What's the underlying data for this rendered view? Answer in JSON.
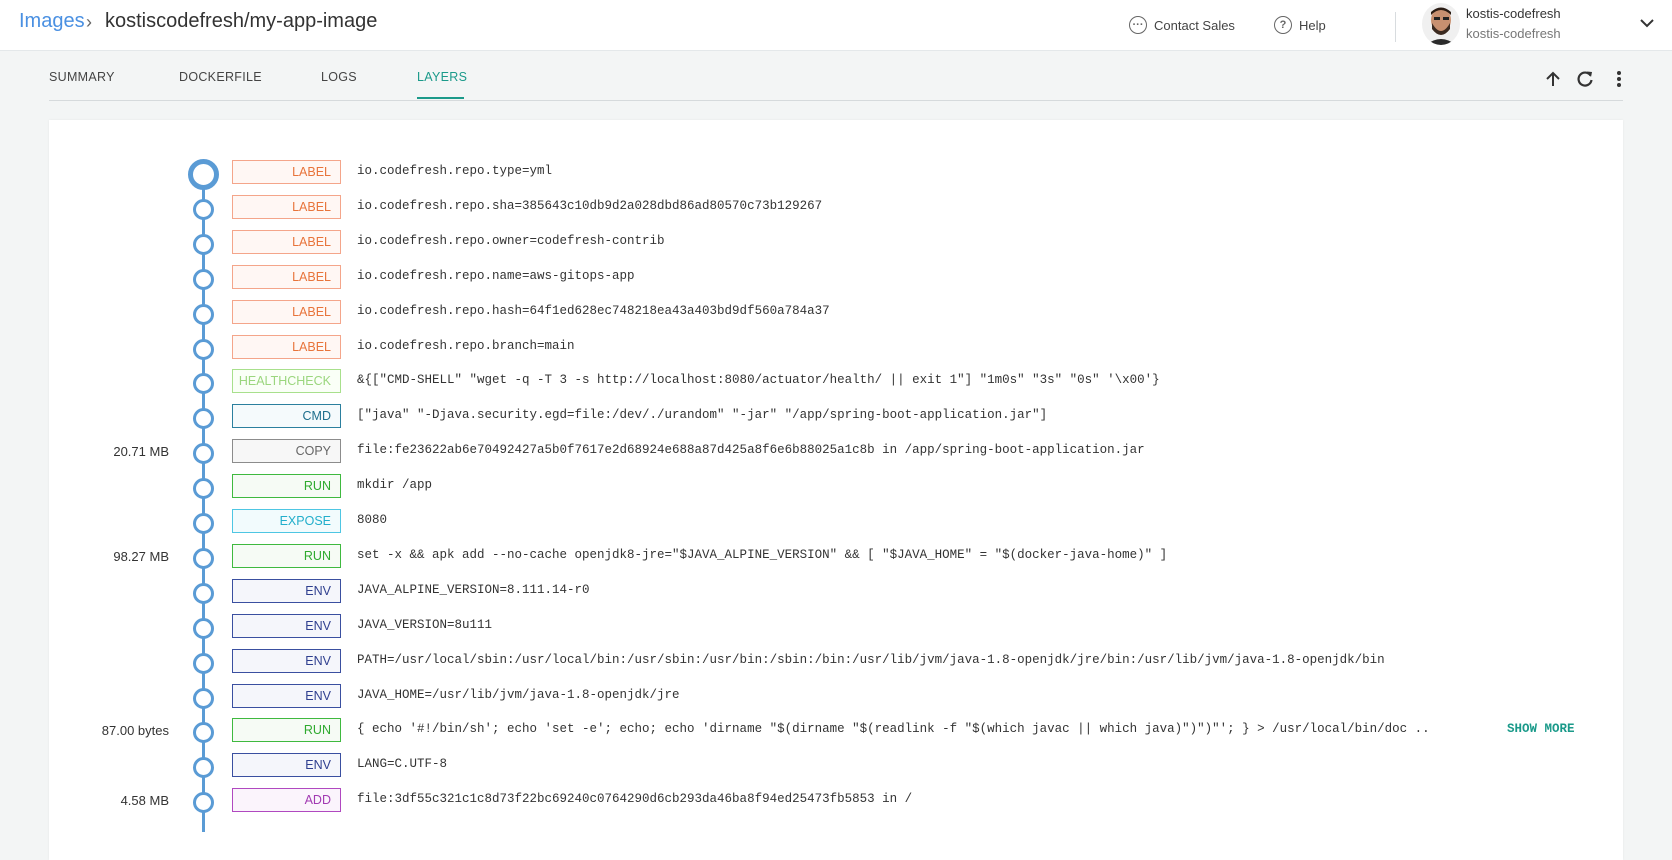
{
  "header": {
    "breadcrumb_root": "Images",
    "breadcrumb_separator": "›",
    "breadcrumb_current": "kostiscodefresh/my-app-image",
    "contact_sales": "Contact Sales",
    "help": "Help",
    "user_name": "kostis-codefresh",
    "user_account": "kostis-codefresh"
  },
  "tabs": [
    {
      "label": "SUMMARY",
      "active": false
    },
    {
      "label": "DOCKERFILE",
      "active": false
    },
    {
      "label": "LOGS",
      "active": false
    },
    {
      "label": "LAYERS",
      "active": true
    }
  ],
  "colors": {
    "LABEL": {
      "border": "#f4a58a",
      "text": "#e8743b",
      "bg": "#fff7f4"
    },
    "HEALTHCHECK": {
      "border": "#a8e08c",
      "text": "#9bd67e",
      "bg": "#fafff7"
    },
    "CMD": {
      "border": "#2b7f9e",
      "text": "#1f6e8c",
      "bg": "#f5fafc"
    },
    "COPY": {
      "border": "#8c8c8c",
      "text": "#666666",
      "bg": "#f7f7f7"
    },
    "RUN": {
      "border": "#3fb93f",
      "text": "#2faa2f",
      "bg": "#f6fbf5"
    },
    "EXPOSE": {
      "border": "#4ec6e3",
      "text": "#22aecb",
      "bg": "#f2fbfd"
    },
    "ENV": {
      "border": "#3a4fa0",
      "text": "#2f3f8f",
      "bg": "#f5f6fb"
    },
    "ADD": {
      "border": "#b048c0",
      "text": "#a23ab2",
      "bg": "#fbf4fc"
    }
  },
  "layers": [
    {
      "type": "LABEL",
      "size": "",
      "command": "io.codefresh.repo.type=yml"
    },
    {
      "type": "LABEL",
      "size": "",
      "command": "io.codefresh.repo.sha=385643c10db9d2a028dbd86ad80570c73b129267"
    },
    {
      "type": "LABEL",
      "size": "",
      "command": "io.codefresh.repo.owner=codefresh-contrib"
    },
    {
      "type": "LABEL",
      "size": "",
      "command": "io.codefresh.repo.name=aws-gitops-app"
    },
    {
      "type": "LABEL",
      "size": "",
      "command": "io.codefresh.repo.hash=64f1ed628ec748218ea43a403bd9df560a784a37"
    },
    {
      "type": "LABEL",
      "size": "",
      "command": "io.codefresh.repo.branch=main"
    },
    {
      "type": "HEALTHCHECK",
      "size": "",
      "command": "&{[\"CMD-SHELL\" \"wget -q -T 3 -s http://localhost:8080/actuator/health/ || exit 1\"] \"1m0s\" \"3s\" \"0s\" '\\x00'}"
    },
    {
      "type": "CMD",
      "size": "",
      "command": "[\"java\" \"-Djava.security.egd=file:/dev/./urandom\" \"-jar\" \"/app/spring-boot-application.jar\"]"
    },
    {
      "type": "COPY",
      "size": "20.71 MB",
      "command": "file:fe23622ab6e70492427a5b0f7617e2d68924e688a87d425a8f6e6b88025a1c8b in /app/spring-boot-application.jar"
    },
    {
      "type": "RUN",
      "size": "",
      "command": "mkdir /app"
    },
    {
      "type": "EXPOSE",
      "size": "",
      "command": "8080"
    },
    {
      "type": "RUN",
      "size": "98.27 MB",
      "command": "set -x && apk add --no-cache openjdk8-jre=\"$JAVA_ALPINE_VERSION\" && [ \"$JAVA_HOME\" = \"$(docker-java-home)\" ]"
    },
    {
      "type": "ENV",
      "size": "",
      "command": "JAVA_ALPINE_VERSION=8.111.14-r0"
    },
    {
      "type": "ENV",
      "size": "",
      "command": "JAVA_VERSION=8u111"
    },
    {
      "type": "ENV",
      "size": "",
      "command": "PATH=/usr/local/sbin:/usr/local/bin:/usr/sbin:/usr/bin:/sbin:/bin:/usr/lib/jvm/java-1.8-openjdk/jre/bin:/usr/lib/jvm/java-1.8-openjdk/bin"
    },
    {
      "type": "ENV",
      "size": "",
      "command": "JAVA_HOME=/usr/lib/jvm/java-1.8-openjdk/jre"
    },
    {
      "type": "RUN",
      "size": "87.00 bytes",
      "command": "{ echo '#!/bin/sh'; echo 'set -e'; echo; echo 'dirname \"$(dirname \"$(readlink -f \"$(which javac || which java)\")\")\"'; } > /usr/local/bin/doc ..",
      "show_more": "SHOW MORE"
    },
    {
      "type": "ENV",
      "size": "",
      "command": "LANG=C.UTF-8"
    },
    {
      "type": "ADD",
      "size": "4.58 MB",
      "command": "file:3df55c321c1c8d73f22bc69240c0764290d6cb293da46ba8f94ed25473fb5853 in /"
    }
  ]
}
